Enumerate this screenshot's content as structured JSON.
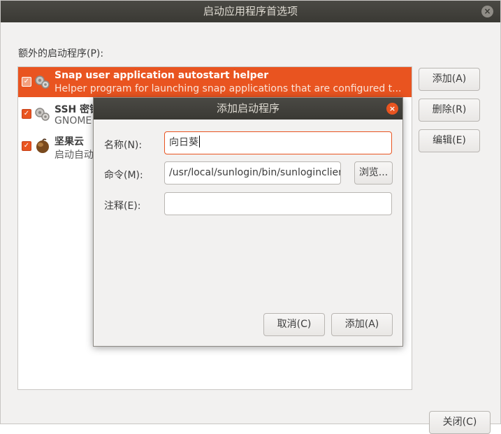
{
  "window": {
    "title": "启动应用程序首选项",
    "close_glyph": "×",
    "section_label": "额外的启动程序(P):",
    "startup_items": [
      {
        "checked": true,
        "icon": "gears-icon",
        "name": "Snap user application autostart helper",
        "description": "Helper program for launching snap applications that are configured t..."
      },
      {
        "checked": true,
        "icon": "gears-icon",
        "name": "SSH 密钥",
        "description": "GNOME"
      },
      {
        "checked": true,
        "icon": "jianguoyun-icon",
        "name": "坚果云",
        "description": "启动自动"
      }
    ],
    "buttons": {
      "add": "添加(A)",
      "remove": "删除(R)",
      "edit": "编辑(E)",
      "close": "关闭(C)"
    },
    "check_glyph": "✓"
  },
  "dialog": {
    "title": "添加启动程序",
    "close_glyph": "×",
    "name_label": "名称(N):",
    "name_value": "向日葵",
    "command_label": "命令(M):",
    "command_value": "/usr/local/sunlogin/bin/sunloginclient",
    "comment_label": "注释(E):",
    "comment_value": "",
    "browse_label": "浏览...",
    "cancel_label": "取消(C)",
    "add_label": "添加(A)"
  },
  "colors": {
    "accent": "#e95420",
    "titlebar": "#3c3b37",
    "window_bg": "#f2f1f0"
  }
}
